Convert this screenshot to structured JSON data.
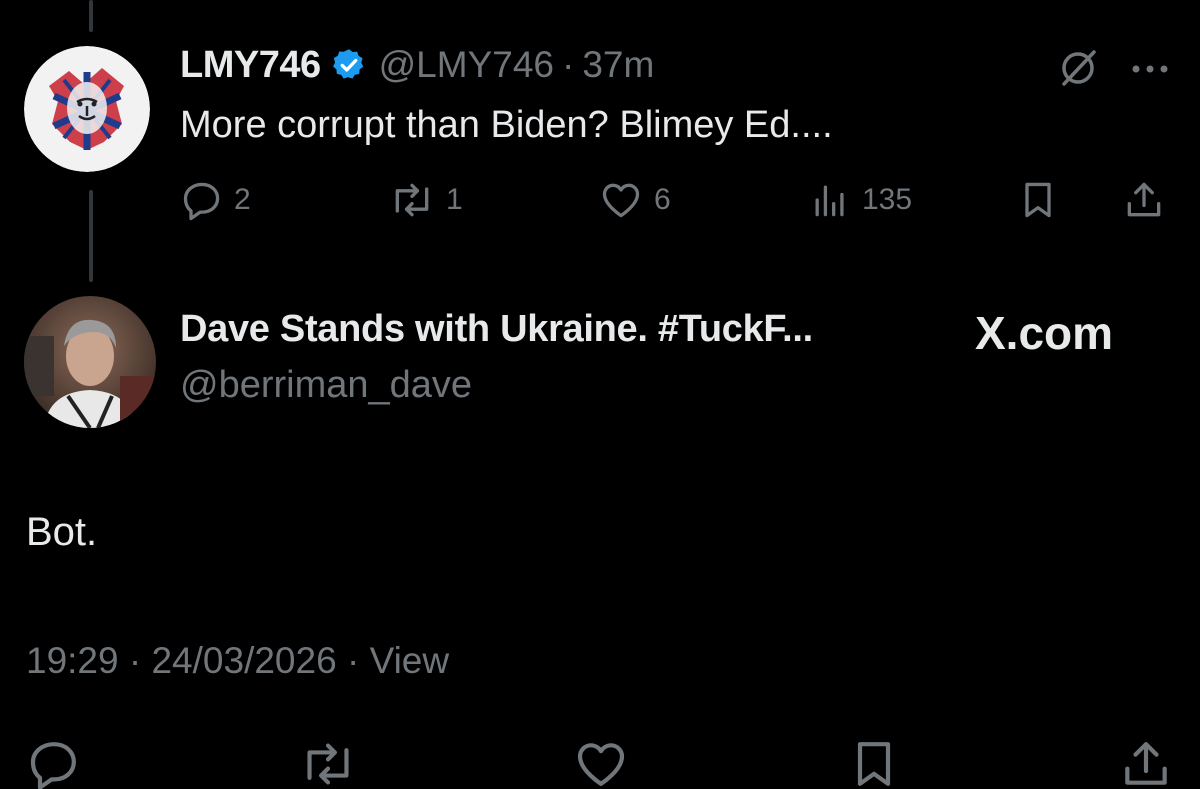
{
  "parent_tweet": {
    "display_name": "LMY746",
    "handle": "@LMY746",
    "time": "37m",
    "text": "More corrupt than Biden? Blimey Ed....",
    "stats": {
      "replies": "2",
      "reposts": "1",
      "likes": "6",
      "views": "135"
    }
  },
  "reply_tweet": {
    "display_name": "Dave Stands with Ukraine. #TuckF...",
    "handle": "@berriman_dave",
    "text": "Bot.",
    "time": "19:29",
    "date": "24/03/2026",
    "view_label": "View"
  },
  "watermark": "X.com",
  "separator": "·",
  "colors": {
    "background": "#000000",
    "text_primary": "#e7e9ea",
    "text_secondary": "#71767b",
    "verified_blue": "#1d9bf0",
    "thread_line": "#333639"
  },
  "icons": {
    "reply": "reply-icon",
    "repost": "repost-icon",
    "like": "heart-icon",
    "views": "views-icon",
    "bookmark": "bookmark-icon",
    "share": "share-icon",
    "grok": "grok-icon",
    "more": "more-icon",
    "verified": "verified-badge-icon"
  }
}
